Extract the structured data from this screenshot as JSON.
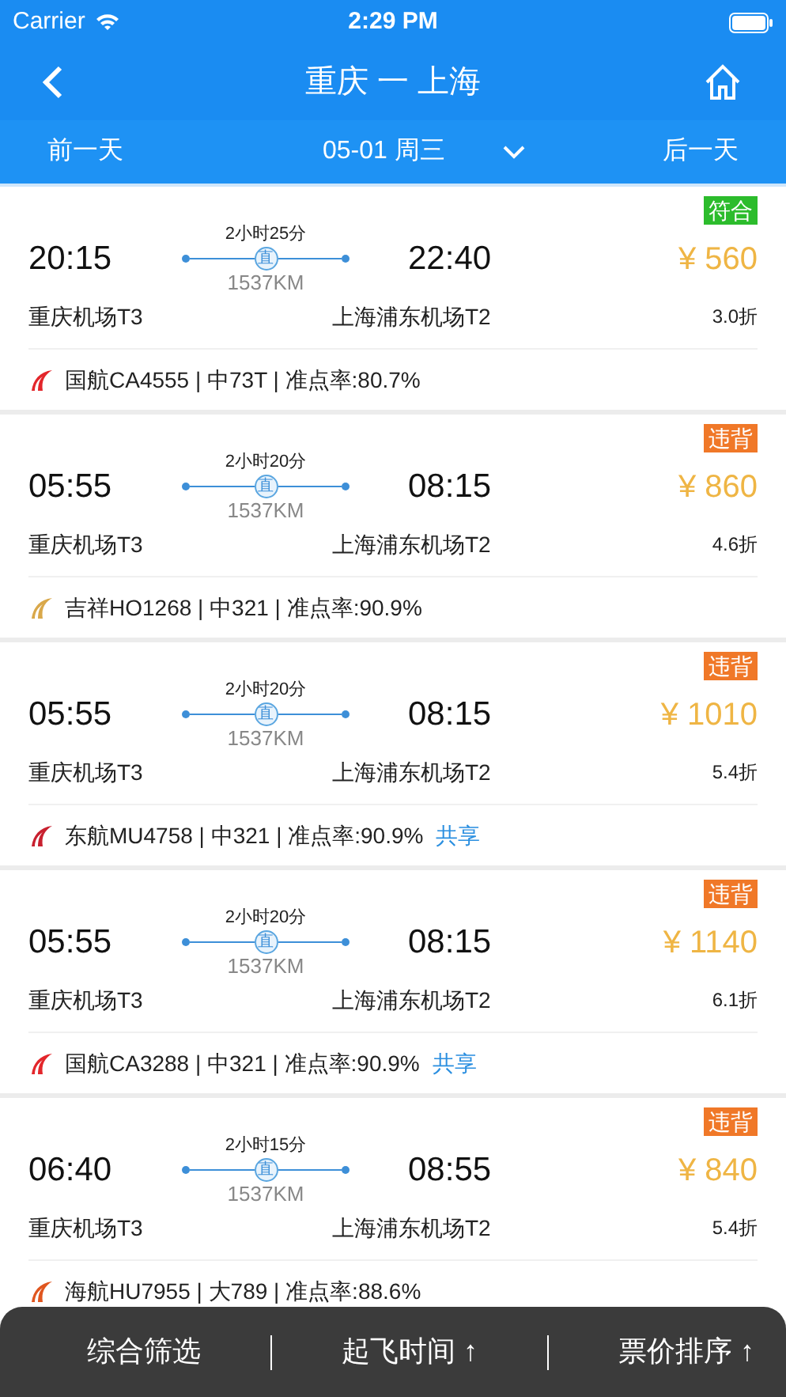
{
  "status_bar": {
    "carrier": "Carrier",
    "time": "2:29 PM"
  },
  "nav": {
    "title": "重庆 一 上海"
  },
  "date_bar": {
    "prev": "前一天",
    "date": "05-01 周三",
    "next": "后一天"
  },
  "flights": [
    {
      "dep_time": "20:15",
      "duration": "2小时25分",
      "direct_mark": "直",
      "distance": "1537KM",
      "arr_time": "22:40",
      "policy": {
        "label": "符合",
        "kind": "compliant"
      },
      "price": "¥ 560",
      "dep_airport": "重庆机场T3",
      "arr_airport": "上海浦东机场T2",
      "discount": "3.0折",
      "airline": {
        "info": "国航CA4555 | 中73T | 准点率:80.7%",
        "color": "#e3262b"
      }
    },
    {
      "dep_time": "05:55",
      "duration": "2小时20分",
      "direct_mark": "直",
      "distance": "1537KM",
      "arr_time": "08:15",
      "policy": {
        "label": "违背",
        "kind": "violation"
      },
      "price": "¥ 860",
      "dep_airport": "重庆机场T3",
      "arr_airport": "上海浦东机场T2",
      "discount": "4.6折",
      "airline": {
        "info": "吉祥HO1268 | 中321 | 准点率:90.9%",
        "color": "#d9a84a"
      }
    },
    {
      "dep_time": "05:55",
      "duration": "2小时20分",
      "direct_mark": "直",
      "distance": "1537KM",
      "arr_time": "08:15",
      "policy": {
        "label": "违背",
        "kind": "violation"
      },
      "price": "¥ 1010",
      "dep_airport": "重庆机场T3",
      "arr_airport": "上海浦东机场T2",
      "discount": "5.4折",
      "airline": {
        "info": "东航MU4758 | 中321 | 准点率:90.9%",
        "color": "#c8202f",
        "shared": "共享"
      }
    },
    {
      "dep_time": "05:55",
      "duration": "2小时20分",
      "direct_mark": "直",
      "distance": "1537KM",
      "arr_time": "08:15",
      "policy": {
        "label": "违背",
        "kind": "violation"
      },
      "price": "¥ 1140",
      "dep_airport": "重庆机场T3",
      "arr_airport": "上海浦东机场T2",
      "discount": "6.1折",
      "airline": {
        "info": "国航CA3288 | 中321 | 准点率:90.9%",
        "color": "#e3262b",
        "shared": "共享"
      }
    },
    {
      "dep_time": "06:40",
      "duration": "2小时15分",
      "direct_mark": "直",
      "distance": "1537KM",
      "arr_time": "08:55",
      "policy": {
        "label": "违背",
        "kind": "violation"
      },
      "price": "¥ 840",
      "dep_airport": "重庆机场T3",
      "arr_airport": "上海浦东机场T2",
      "discount": "5.4折",
      "airline": {
        "info": "海航HU7955 | 大789 | 准点率:88.6%",
        "color": "#e0561f"
      }
    }
  ],
  "sort_bar": [
    "综合筛选",
    "起飞时间 ↑",
    "票价排序 ↑"
  ]
}
